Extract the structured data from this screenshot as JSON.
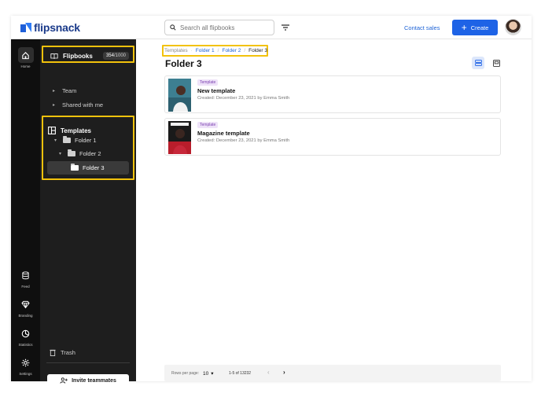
{
  "header": {
    "logo_text": "flipsnack",
    "search_placeholder": "Search all flipbooks",
    "contact_label": "Contact sales",
    "create_label": "Create"
  },
  "rail": {
    "items": [
      {
        "label": "Home",
        "icon": "home-icon"
      },
      {
        "label": "Feed",
        "icon": "database-icon"
      },
      {
        "label": "Branding",
        "icon": "diamond-icon"
      },
      {
        "label": "Statistics",
        "icon": "pie-chart-icon"
      },
      {
        "label": "Settings",
        "icon": "gear-icon"
      }
    ]
  },
  "sidebar": {
    "flipbooks_label": "Flipbooks",
    "count_used": "354",
    "count_total": "/1000",
    "team_label": "Team",
    "shared_label": "Shared with me",
    "templates_label": "Templates",
    "folders": [
      "Folder 1",
      "Folder 2",
      "Folder 3"
    ],
    "trash_label": "Trash",
    "invite_label": "Invite teammates",
    "highlight_color": "#f2c20c"
  },
  "main": {
    "breadcrumbs": [
      "Templates",
      "Folder 1",
      "Folder 2",
      "Folder 3"
    ],
    "title": "Folder 3",
    "items": [
      {
        "badge": "Template",
        "title": "New template",
        "meta": "Created: December 23, 2021 by Emma Smith"
      },
      {
        "badge": "Template",
        "title": "Magazine template",
        "meta": "Created: December 23, 2021 by Emma Smith"
      }
    ],
    "footer": {
      "rows_label": "Rows per page:",
      "rows_value": "10",
      "range": "1-5 of 13232"
    }
  },
  "colors": {
    "accent": "#1e63e6",
    "sidebar_bg": "#1e1e1e",
    "rail_bg": "#0f0f0f",
    "badge_bg": "#eee2f8"
  }
}
